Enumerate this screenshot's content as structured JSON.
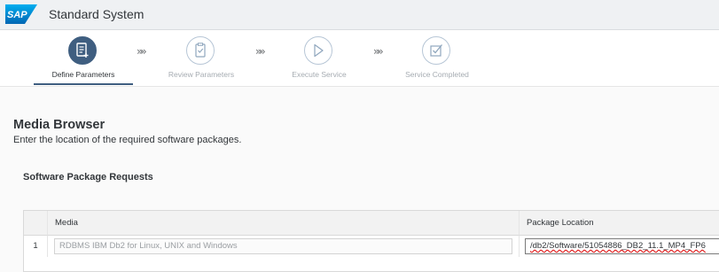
{
  "shell": {
    "logo_text": "SAP",
    "title": "Standard System"
  },
  "wizard": {
    "steps": [
      {
        "label": "Define Parameters",
        "icon": "document-icon",
        "state": "active"
      },
      {
        "label": "Review Parameters",
        "icon": "clipboard-check-icon",
        "state": "inactive"
      },
      {
        "label": "Execute Service",
        "icon": "play-icon",
        "state": "inactive"
      },
      {
        "label": "Service Completed",
        "icon": "checkbox-icon",
        "state": "inactive"
      }
    ],
    "separator": "»»"
  },
  "page": {
    "title": "Media Browser",
    "description": "Enter the location of the required software packages."
  },
  "table": {
    "title": "Software Package Requests",
    "columns": [
      "Media",
      "Package Location"
    ],
    "rows": [
      {
        "number": "1",
        "media": "RDBMS IBM Db2 for Linux, UNIX and Windows",
        "location": "/db2/Software/51054886_DB2_11.1_MP4_FP6"
      }
    ]
  },
  "colors": {
    "accent": "#3f5e80",
    "inactive": "#b7c6d6",
    "logo_blue": "#0a6ed1"
  }
}
